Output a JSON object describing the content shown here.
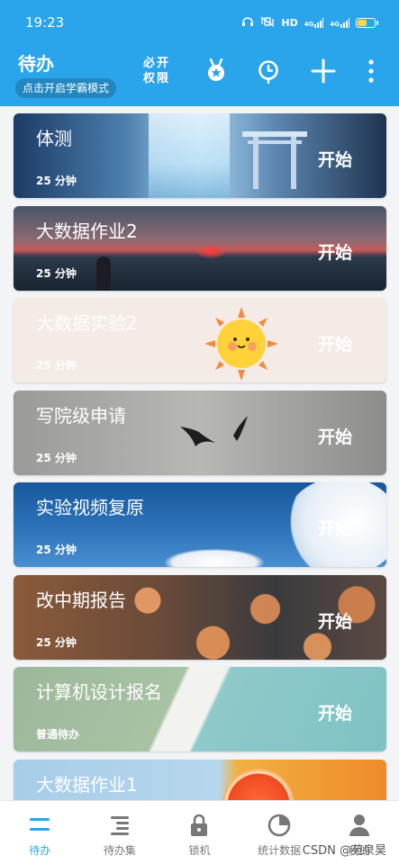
{
  "status_bar": {
    "time": "19:23",
    "network": "HD",
    "signal1": "4G",
    "signal2": "4G"
  },
  "header": {
    "title": "待办",
    "mode_button": "点击开启学霸模式",
    "perm_line1": "必开",
    "perm_line2": "权限",
    "icons": [
      "medal-icon",
      "clock-icon",
      "add-icon",
      "more-icon"
    ]
  },
  "tasks": [
    {
      "title": "体测",
      "subtitle": "25 分钟",
      "action": "开始"
    },
    {
      "title": "大数据作业2",
      "subtitle": "25 分钟",
      "action": "开始"
    },
    {
      "title": "大数据实验2",
      "subtitle": "25 分钟",
      "action": "开始"
    },
    {
      "title": "写院级申请",
      "subtitle": "25 分钟",
      "action": "开始"
    },
    {
      "title": "实验视频复原",
      "subtitle": "25 分钟",
      "action": "开始"
    },
    {
      "title": "改中期报告",
      "subtitle": "25 分钟",
      "action": "开始"
    },
    {
      "title": "计算机设计报名",
      "subtitle": "普通待办",
      "action": "开始"
    },
    {
      "title": "大数据作业1",
      "subtitle": "",
      "action": ""
    }
  ],
  "bottom_nav": [
    {
      "label": "待办",
      "icon": "todo-list-icon",
      "active": true
    },
    {
      "label": "待办集",
      "icon": "todo-set-icon",
      "active": false
    },
    {
      "label": "锁机",
      "icon": "lock-icon",
      "active": false
    },
    {
      "label": "统计数据",
      "icon": "stats-icon",
      "active": false
    },
    {
      "label": "我的",
      "icon": "profile-icon",
      "active": false
    }
  ],
  "watermark": "CSDN @苑泉昊",
  "colors": {
    "primary": "#2aa4ea",
    "nav_inactive": "#777777"
  }
}
